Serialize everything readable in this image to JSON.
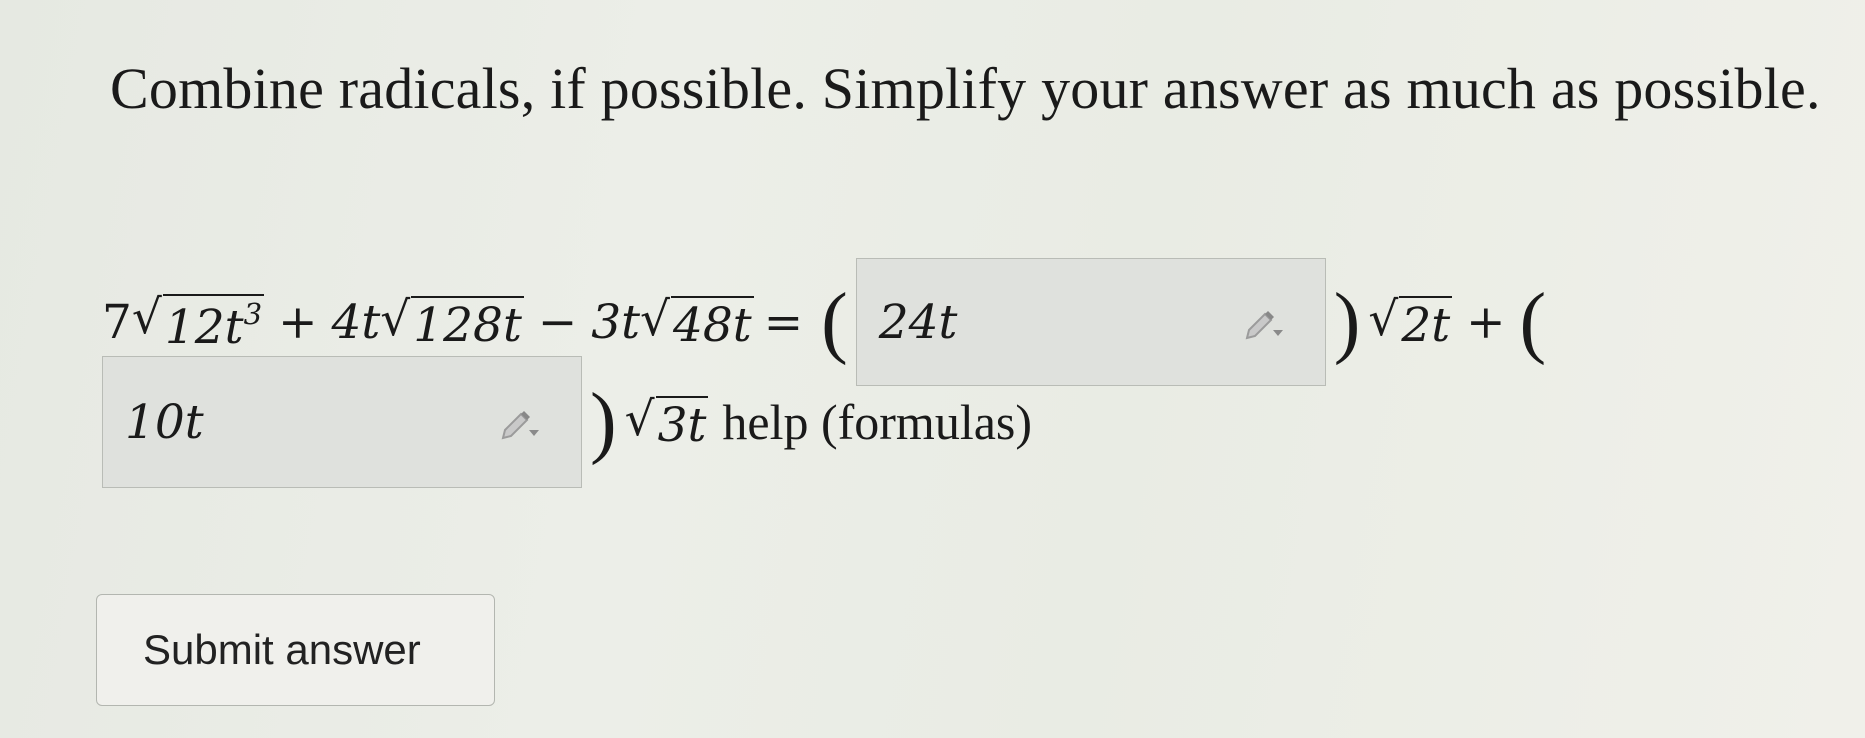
{
  "question": {
    "prompt": "Combine radicals, if possible. Simplify your answer as much as possible."
  },
  "expression": {
    "term1_coef": "7",
    "term1_radicand": "12t",
    "term1_exp": "3",
    "op1": "+",
    "term2_coef": "4t",
    "term2_radicand": "128t",
    "op2": "−",
    "term3_coef": "3t",
    "term3_radicand": "48t",
    "equals": "=",
    "open_paren": "(",
    "close_paren": ")",
    "rad_a": "2t",
    "op3": "+",
    "rad_b": "3t"
  },
  "answers": {
    "box1_value": "24t",
    "box2_value": "10t",
    "edit_icon": "pencil-dropdown-icon"
  },
  "help_link": "help (formulas)",
  "submit_label": "Submit answer"
}
